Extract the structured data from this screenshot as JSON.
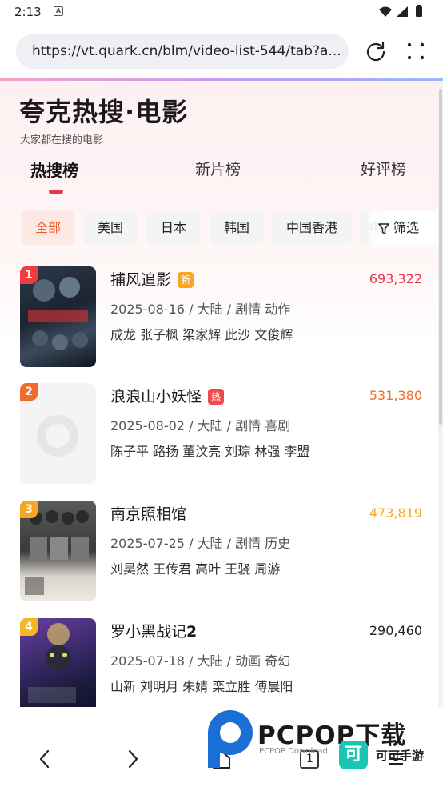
{
  "status": {
    "time": "2:13",
    "notification_icon": "A"
  },
  "browser": {
    "url": "https://vt.quark.cn/blm/video-list-544/tab?a...",
    "reload_icon": "refresh-icon",
    "menu_icon": "more-dots-icon"
  },
  "header": {
    "brand_a": "夸克",
    "brand_hot": "热",
    "brand_b": "搜·电影",
    "subtitle": "大家都在搜的电影"
  },
  "tabs": [
    {
      "label": "热搜榜",
      "active": true
    },
    {
      "label": "新片榜",
      "active": false
    },
    {
      "label": "好评榜",
      "active": false
    }
  ],
  "chips": [
    {
      "label": "全部",
      "active": true
    },
    {
      "label": "美国"
    },
    {
      "label": "日本"
    },
    {
      "label": "韩国"
    },
    {
      "label": "中国香港"
    },
    {
      "label": "中"
    }
  ],
  "filter_label": "筛选",
  "movies": [
    {
      "rank": "1",
      "title": "捕风追影",
      "tag": "新",
      "tag_color": "#f5a623",
      "meta": "2025-08-16 / 大陆 / 剧情 动作",
      "cast": "成龙 张子枫 梁家辉 此沙 文俊辉",
      "score": "693,322",
      "score_color": "#e8354b",
      "rank_color": "#f03c3c"
    },
    {
      "rank": "2",
      "title": "浪浪山小妖怪",
      "tag": "热",
      "tag_color": "#f04a4a",
      "meta": "2025-08-02 / 大陆 / 剧情 喜剧",
      "cast": "陈子平 路扬 董汶亮 刘琮 林强 李盟",
      "score": "531,380",
      "score_color": "#f26b2c",
      "rank_color": "#f26b2c"
    },
    {
      "rank": "3",
      "title": "南京照相馆",
      "tag": "",
      "tag_color": "",
      "meta": "2025-07-25 / 大陆 / 剧情 历史",
      "cast": "刘昊然 王传君 高叶 王骁 周游",
      "score": "473,819",
      "score_color": "#f5a623",
      "rank_color": "#f5a623"
    },
    {
      "rank": "4",
      "title_a": "罗小黑战记",
      "title_b": "2",
      "title": "罗小黑战记2",
      "tag": "",
      "tag_color": "",
      "meta": "2025-07-18 / 大陆 / 动画 奇幻",
      "cast": "山新 刘明月 朱婧 栾立胜 傅晨阳",
      "score": "290,460",
      "score_color": "#222222",
      "rank_color": "#f5b623"
    }
  ],
  "bottom_nav": {
    "back_icon": "back-arrow-icon",
    "forward_icon": "forward-arrow-icon",
    "home_icon": "home-icon",
    "tabs_count": "1",
    "menu_icon": "menu-icon"
  },
  "watermark": {
    "brand": "PCPOP下载",
    "sub": "PCPOP Download",
    "app_char": "可",
    "app_name": "可可手游"
  }
}
